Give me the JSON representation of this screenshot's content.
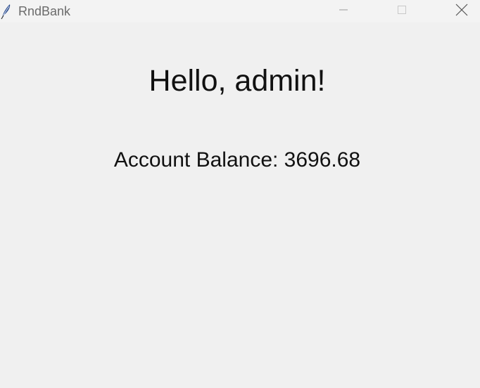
{
  "window": {
    "title": "RndBank",
    "icon": "feather-icon",
    "controls": [
      "minimize-icon",
      "maximize-icon",
      "close-icon"
    ]
  },
  "main": {
    "greeting": "Hello, admin!",
    "balance_text": "Account Balance: 3696.68"
  },
  "colors": {
    "background": "#f0f0f0",
    "titlebar": "#f3f3f3",
    "text": "#111111",
    "title_text": "#6b6b6b"
  }
}
